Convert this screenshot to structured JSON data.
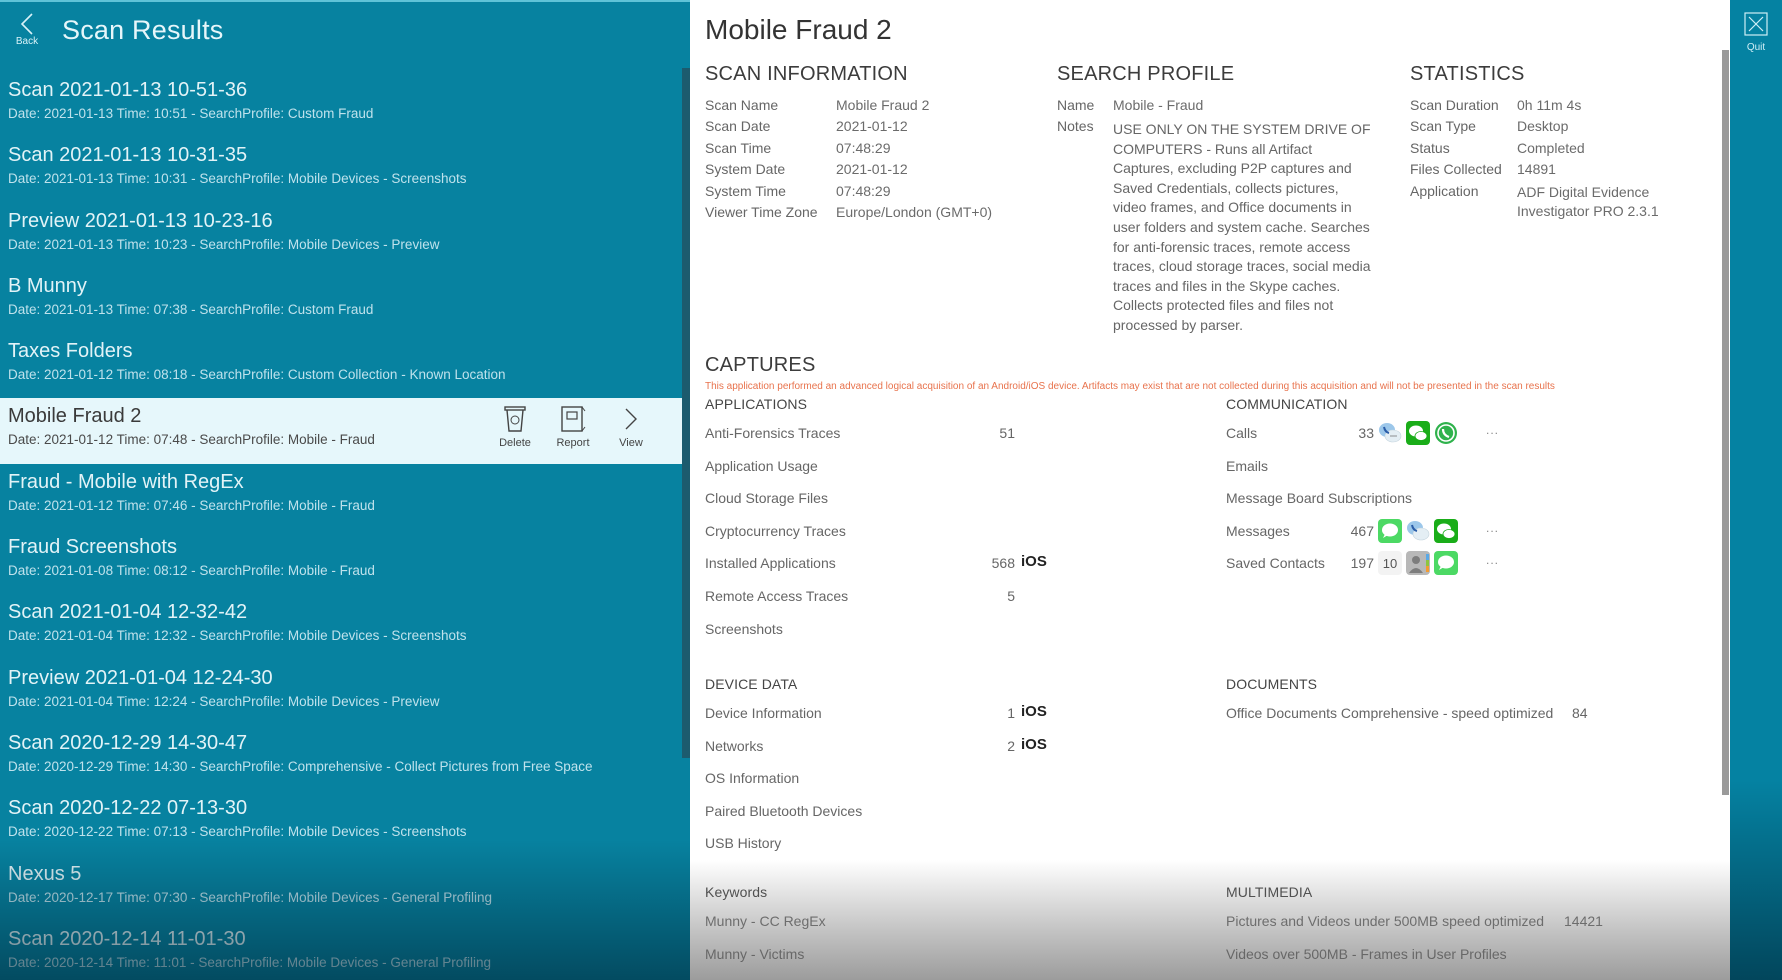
{
  "left": {
    "back_label": "Back",
    "title": "Scan Results",
    "scans": [
      {
        "name": "Scan 2021-01-13 10-51-36",
        "meta": "Date: 2021-01-13 Time: 10:51 - SearchProfile: Custom Fraud"
      },
      {
        "name": "Scan 2021-01-13 10-31-35",
        "meta": "Date: 2021-01-13 Time: 10:31 - SearchProfile: Mobile Devices - Screenshots"
      },
      {
        "name": "Preview 2021-01-13 10-23-16",
        "meta": "Date: 2021-01-13 Time: 10:23 - SearchProfile: Mobile Devices - Preview"
      },
      {
        "name": "B Munny",
        "meta": "Date: 2021-01-13 Time: 07:38 - SearchProfile: Custom Fraud"
      },
      {
        "name": "Taxes Folders",
        "meta": "Date: 2021-01-12 Time: 08:18 - SearchProfile: Custom Collection - Known Location"
      },
      {
        "name": "Mobile Fraud 2",
        "meta": "Date: 2021-01-12 Time: 07:48 - SearchProfile: Mobile - Fraud",
        "selected": true
      },
      {
        "name": "Fraud - Mobile with RegEx",
        "meta": "Date: 2021-01-12 Time: 07:46 - SearchProfile: Mobile - Fraud"
      },
      {
        "name": "Fraud Screenshots",
        "meta": "Date: 2021-01-08 Time: 08:12 - SearchProfile: Mobile - Fraud"
      },
      {
        "name": "Scan 2021-01-04 12-32-42",
        "meta": "Date: 2021-01-04 Time: 12:32 - SearchProfile: Mobile Devices - Screenshots"
      },
      {
        "name": "Preview 2021-01-04 12-24-30",
        "meta": "Date: 2021-01-04 Time: 12:24 - SearchProfile: Mobile Devices - Preview"
      },
      {
        "name": "Scan 2020-12-29 14-30-47",
        "meta": "Date: 2020-12-29 Time: 14:30 - SearchProfile: Comprehensive - Collect Pictures from Free Space"
      },
      {
        "name": "Scan 2020-12-22 07-13-30",
        "meta": "Date: 2020-12-22 Time: 07:13 - SearchProfile: Mobile Devices - Screenshots"
      },
      {
        "name": "Nexus 5",
        "meta": "Date: 2020-12-17 Time: 07:30 - SearchProfile: Mobile Devices - General Profiling"
      },
      {
        "name": "Scan 2020-12-14 11-01-30",
        "meta": "Date: 2020-12-14 Time: 11:01 - SearchProfile: Mobile Devices - General Profiling"
      }
    ],
    "row_actions": {
      "delete": "Delete",
      "report": "Report",
      "view": "View"
    }
  },
  "detail": {
    "title": "Mobile Fraud 2",
    "scan_information": {
      "heading": "SCAN INFORMATION",
      "rows": [
        {
          "k": "Scan Name",
          "v": "Mobile Fraud 2"
        },
        {
          "k": "Scan Date",
          "v": "2021-01-12"
        },
        {
          "k": "Scan Time",
          "v": "07:48:29"
        },
        {
          "k": "System Date",
          "v": "2021-01-12"
        },
        {
          "k": "System Time",
          "v": "07:48:29"
        },
        {
          "k": "Viewer Time Zone",
          "v": "Europe/London (GMT+0)"
        }
      ]
    },
    "search_profile": {
      "heading": "SEARCH PROFILE",
      "name_label": "Name",
      "name_value": "Mobile - Fraud",
      "notes_label": "Notes",
      "notes_value": "USE ONLY ON THE SYSTEM DRIVE OF COMPUTERS - Runs all Artifact Captures, excluding P2P captures and Saved Credentials, collects pictures, video frames, and Office documents in user folders and system cache. Searches for anti-forensic traces, remote access traces, cloud storage traces, social media traces and files in the Skype caches. Collects protected files and files not processed by parser."
    },
    "statistics": {
      "heading": "STATISTICS",
      "rows": [
        {
          "k": "Scan Duration",
          "v": "0h 11m 4s"
        },
        {
          "k": "Scan Type",
          "v": "Desktop"
        },
        {
          "k": "Status",
          "v": "Completed"
        },
        {
          "k": "Files Collected",
          "v": "14891"
        },
        {
          "k": "Application",
          "v": "ADF Digital Evidence Investigator PRO 2.3.1"
        }
      ]
    },
    "captures": {
      "heading": "CAPTURES",
      "warning": "This application performed an advanced logical acquisition of an Android/iOS device. Artifacts may exist that are not collected during this acquisition and will not be presented in the scan results",
      "applications": {
        "heading": "APPLICATIONS",
        "items": [
          {
            "label": "Anti-Forensics Traces",
            "count": "51",
            "os": ""
          },
          {
            "label": "Application Usage",
            "count": "",
            "os": ""
          },
          {
            "label": "Cloud Storage Files",
            "count": "",
            "os": ""
          },
          {
            "label": "Cryptocurrency Traces",
            "count": "",
            "os": ""
          },
          {
            "label": "Installed Applications",
            "count": "568",
            "os": "iOS"
          },
          {
            "label": "Remote Access Traces",
            "count": "5",
            "os": ""
          },
          {
            "label": "Screenshots",
            "count": "",
            "os": ""
          }
        ]
      },
      "communication": {
        "heading": "COMMUNICATION",
        "items": [
          {
            "label": "Calls",
            "count": "33",
            "icons": [
              "voip-call-icon",
              "wechat-icon",
              "whatsapp-icon"
            ],
            "more": "..."
          },
          {
            "label": "Emails",
            "count": "",
            "icons": [],
            "more": ""
          },
          {
            "label": "Message Board Subscriptions",
            "count": "",
            "icons": [],
            "more": ""
          },
          {
            "label": "Messages",
            "count": "467",
            "icons": [
              "imessage-icon",
              "voip-call-icon",
              "wechat-icon"
            ],
            "more": "..."
          },
          {
            "label": "Saved Contacts",
            "count": "197",
            "icons": [
              "calendar-icon",
              "contacts-icon",
              "imessage-icon"
            ],
            "more": "..."
          }
        ]
      },
      "device_data": {
        "heading": "DEVICE DATA",
        "items": [
          {
            "label": "Device Information",
            "count": "1",
            "os": "iOS"
          },
          {
            "label": "Networks",
            "count": "2",
            "os": "iOS"
          },
          {
            "label": "OS Information",
            "count": "",
            "os": ""
          },
          {
            "label": "Paired Bluetooth Devices",
            "count": "",
            "os": ""
          },
          {
            "label": "USB History",
            "count": "",
            "os": ""
          }
        ]
      },
      "documents": {
        "heading": "DOCUMENTS",
        "items": [
          {
            "label": "Office Documents Comprehensive - speed optimized",
            "count": "84"
          }
        ]
      },
      "keywords": {
        "heading": "Keywords",
        "items": [
          {
            "label": "Munny - CC RegEx"
          },
          {
            "label": "Munny - Victims"
          }
        ]
      },
      "multimedia": {
        "heading": "MULTIMEDIA",
        "items": [
          {
            "label": "Pictures and Videos under 500MB speed optimized",
            "count": "14421"
          },
          {
            "label": "Videos over 500MB - Frames in User Profiles",
            "count": ""
          }
        ]
      }
    }
  },
  "strip": {
    "quit_label": "Quit"
  },
  "icon_calendar_day": "10",
  "colors": {
    "teal": "#0782a0",
    "selected_row": "#e6f7fb",
    "warning": "#e8734d",
    "wechat_green": "#1aad19",
    "imessage_green": "#4cd964"
  }
}
